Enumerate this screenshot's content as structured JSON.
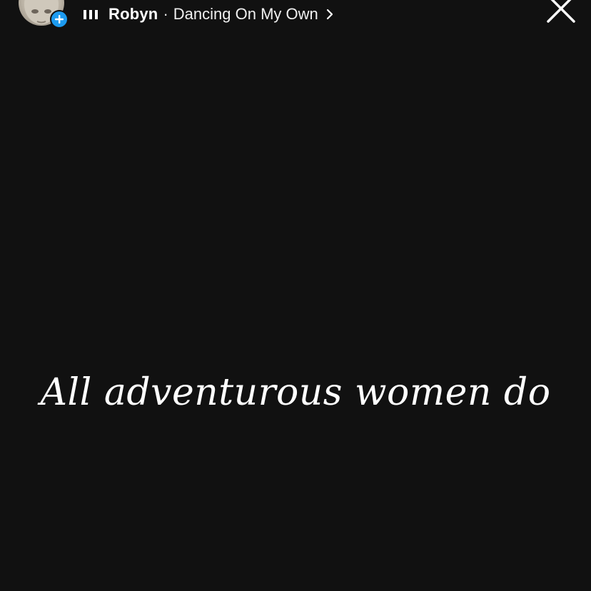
{
  "music": {
    "artist": "Robyn",
    "separator": "·",
    "song": "Dancing On My Own"
  },
  "icons": {
    "music": "music-bars-icon",
    "chevron": "chevron-right-icon",
    "close": "close-icon",
    "add": "plus-icon"
  },
  "story": {
    "caption": "All adventurous women do"
  },
  "colors": {
    "background": "#111111",
    "text": "#ffffff",
    "accent": "#1d9bf0"
  }
}
